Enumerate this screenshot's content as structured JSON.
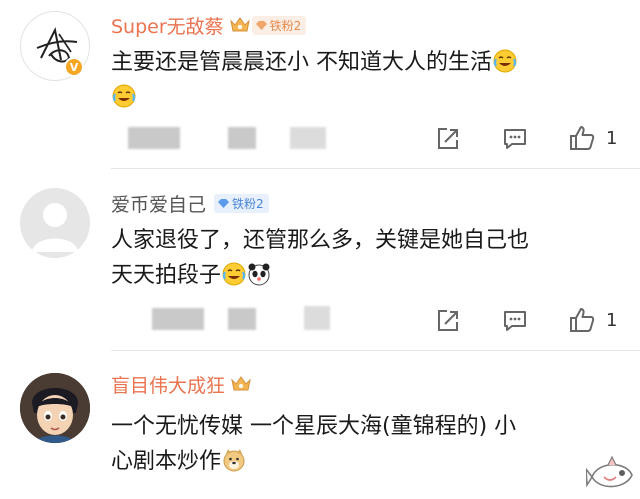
{
  "comments": [
    {
      "username": "Super无敌蔡",
      "fan_badge": "铁粉2",
      "verified_mark": "V",
      "text_line1": "主要还是管晨晨还小 不知道大人的生活",
      "likes": "1",
      "avatar_icon": "signature-avatar-icon"
    },
    {
      "username": "爱币爱自己",
      "fan_badge": "铁粉2",
      "text_line1": "人家退役了，还管那么多，关键是她自己也",
      "text_line2": "天天拍段子",
      "likes": "1",
      "avatar_icon": "default-avatar-icon"
    },
    {
      "username": "盲目伟大成狂",
      "text_line1": "一个无忧传媒 一个星辰大海(童锦程的) 小",
      "text_line2": "心剧本炒作",
      "avatar_icon": "cartoon-avatar-icon"
    }
  ],
  "colors": {
    "vip_name": "#eb7350",
    "plain_name": "#555555",
    "gold_badge_bg": "#fbeee5",
    "blue_badge_bg": "#e7f0fc"
  },
  "icons": [
    "share-icon",
    "comment-icon",
    "like-icon",
    "laugh-cry-emoji",
    "panda-emoji",
    "doge-emoji",
    "crown-icon",
    "fish-watermark-icon"
  ]
}
